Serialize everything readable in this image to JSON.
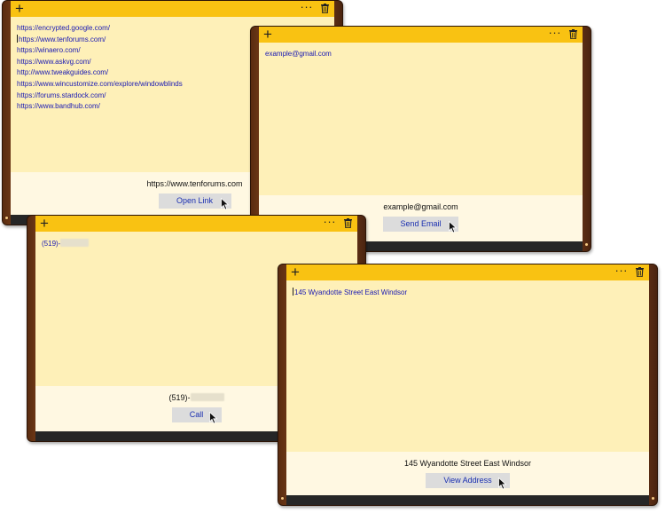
{
  "notes": {
    "links": {
      "items": [
        "https://encrypted.google.com/",
        "https://www.tenforums.com/",
        "https://winaero.com/",
        "https://www.askvg.com/",
        "http://www.tweakguides.com/",
        "https://www.wincustomize.com/explore/windowblinds",
        "https://forums.stardock.com/",
        "https://www.bandhub.com/"
      ],
      "selected_text": "https://www.tenforums.com",
      "button_label": "Open Link"
    },
    "email": {
      "content": "example@gmail.com",
      "selected_text": "example@gmail.com",
      "button_label": "Send Email"
    },
    "phone": {
      "content": "(519)-",
      "selected_text": "(519)-",
      "button_label": "Call"
    },
    "address": {
      "content": "145 Wyandotte Street East Windsor",
      "selected_text": "145 Wyandotte Street East Windsor",
      "button_label": "View Address"
    }
  },
  "ui": {
    "add_glyph": "+",
    "more_glyph": "···"
  },
  "colors": {
    "title_bar": "#f9c212",
    "note_body": "#fef0b8",
    "footer": "#fff8e2",
    "link_text": "#1818b4",
    "action_button": "#dcdcdc",
    "bottom_bar": "#262626"
  },
  "icons": [
    "plus-icon",
    "more-icon",
    "trash-icon",
    "mouse-cursor-icon"
  ]
}
